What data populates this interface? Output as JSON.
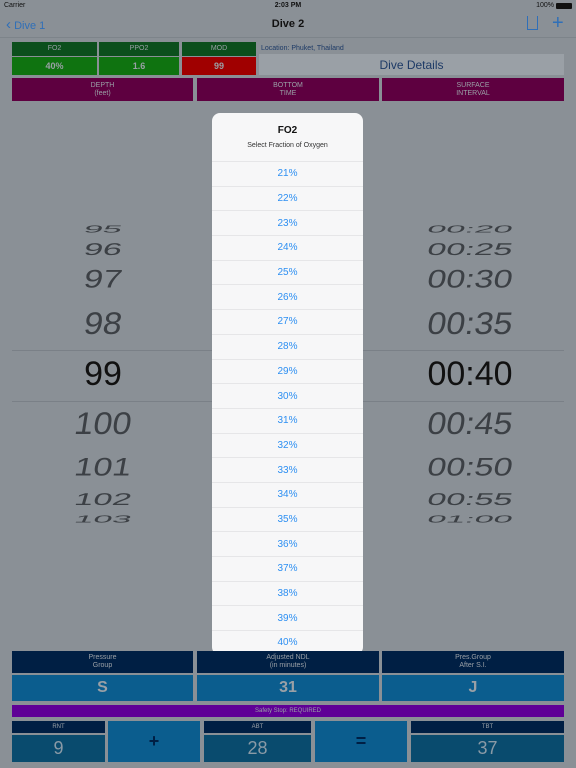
{
  "status": {
    "carrier": "Carrier",
    "time": "2:03 PM",
    "battery": "100%"
  },
  "nav": {
    "back": "Dive 1",
    "title": "Dive 2",
    "icons": [
      "share-icon",
      "plus-icon"
    ]
  },
  "gas": {
    "fo2_label": "FO2",
    "fo2": "40%",
    "ppo2_label": "PPO2",
    "ppo2": "1.6",
    "mod_label": "MOD",
    "mod": "99"
  },
  "location": "Location: Phuket, Thailand",
  "details_button": "Dive Details",
  "columns": {
    "depth": [
      "DEPTH",
      "(feet)"
    ],
    "bottom": [
      "BOTTOM",
      "TIME"
    ],
    "surface": [
      "SURFACE",
      "INTERVAL"
    ]
  },
  "depth_picker": [
    "95",
    "96",
    "97",
    "98",
    "99",
    "100",
    "101",
    "102",
    "103"
  ],
  "time_picker": [
    "00:20",
    "00:25",
    "00:30",
    "00:35",
    "00:40",
    "00:45",
    "00:50",
    "00:55",
    "01:00"
  ],
  "popover": {
    "title": "FO2",
    "subtitle": "Select Fraction of Oxygen",
    "options": [
      "21%",
      "22%",
      "23%",
      "24%",
      "25%",
      "26%",
      "27%",
      "28%",
      "29%",
      "30%",
      "31%",
      "32%",
      "33%",
      "34%",
      "35%",
      "36%",
      "37%",
      "38%",
      "39%",
      "40%"
    ]
  },
  "results": {
    "pg_label": [
      "Pressure",
      "Group"
    ],
    "pg": "S",
    "ndl_label": [
      "Adjusted NDL",
      "(in minutes)"
    ],
    "ndl": "31",
    "pgsi_label": [
      "Pres.Group",
      "After S.I."
    ],
    "pgsi": "J"
  },
  "safety": "Safety Stop: REQUIRED",
  "totals": {
    "rnt_label": "RNT",
    "rnt": "9",
    "plus": "+",
    "abt_label": "ABT",
    "abt": "28",
    "equals": "=",
    "tbt_label": "TBT",
    "tbt": "37"
  }
}
